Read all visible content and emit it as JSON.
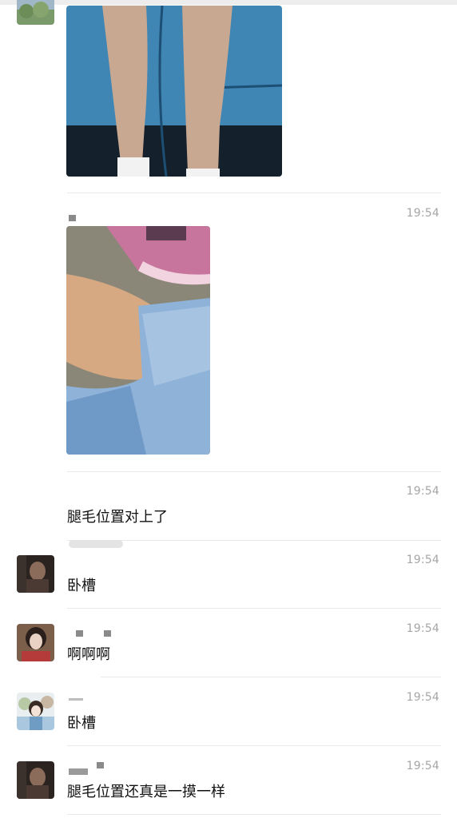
{
  "messages": [
    {
      "id": "m1",
      "time": "19:54"
    },
    {
      "id": "m2",
      "time": "19:54",
      "text": "腿毛位置对上了"
    },
    {
      "id": "m3",
      "time": "19:54",
      "text": "卧槽"
    },
    {
      "id": "m4",
      "time": "19:54",
      "text": "啊啊啊"
    },
    {
      "id": "m5",
      "time": "19:54",
      "text": "卧槽"
    },
    {
      "id": "m6",
      "time": "19:54",
      "text": "腿毛位置还真是一摸一样"
    }
  ],
  "colors": {
    "background": "#ffffff",
    "timestamp": "#a6a6a6",
    "divider": "#e9e9e9"
  }
}
